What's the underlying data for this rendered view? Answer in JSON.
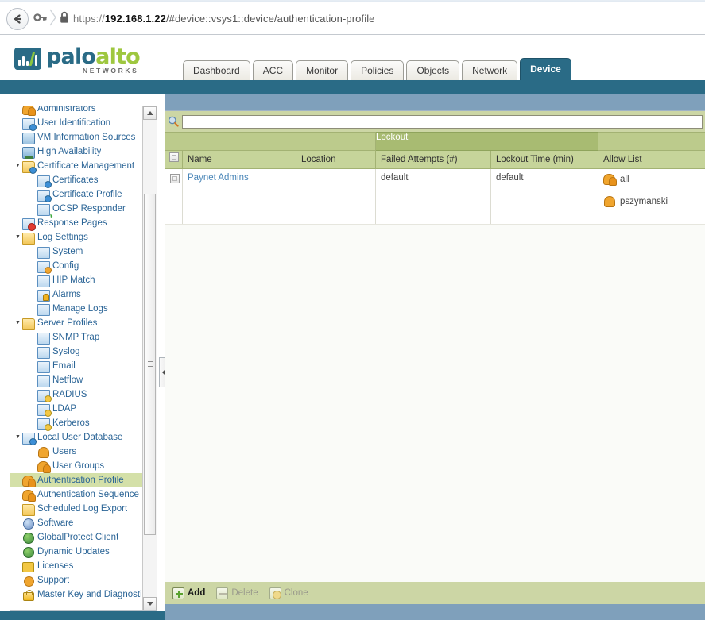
{
  "browser": {
    "url_scheme": "https://",
    "url_host": "192.168.1.22",
    "url_path": "/#device::vsys1::device/authentication-profile",
    "back_icon": "back-arrow-icon",
    "permission_icon": "key-permission-icon",
    "lock_icon": "padlock-secure-icon"
  },
  "brand": {
    "name_part1": "palo",
    "name_part2": "alto",
    "tagline": "NETWORKS",
    "color_primary": "#2a6b86",
    "color_accent": "#9ec73f"
  },
  "tabs": [
    {
      "label": "Dashboard",
      "active": false
    },
    {
      "label": "ACC",
      "active": false
    },
    {
      "label": "Monitor",
      "active": false
    },
    {
      "label": "Policies",
      "active": false
    },
    {
      "label": "Objects",
      "active": false
    },
    {
      "label": "Network",
      "active": false
    },
    {
      "label": "Device",
      "active": true
    }
  ],
  "sidebar": {
    "items": [
      {
        "label": "Administrators",
        "depth": 1,
        "icon": "users-icon",
        "expander": "",
        "selected": false
      },
      {
        "label": "User Identification",
        "depth": 1,
        "icon": "user-id-card-icon",
        "expander": "",
        "selected": false
      },
      {
        "label": "VM Information Sources",
        "depth": 1,
        "icon": "monitor-icon",
        "expander": "",
        "selected": false
      },
      {
        "label": "High Availability",
        "depth": 1,
        "icon": "high-availability-icon",
        "expander": "",
        "selected": false
      },
      {
        "label": "Certificate Management",
        "depth": 1,
        "icon": "folder-certificate-icon",
        "expander": "▼",
        "selected": false
      },
      {
        "label": "Certificates",
        "depth": 2,
        "icon": "certificate-icon",
        "expander": "",
        "selected": false
      },
      {
        "label": "Certificate Profile",
        "depth": 2,
        "icon": "certificate-icon",
        "expander": "",
        "selected": false
      },
      {
        "label": "OCSP Responder",
        "depth": 2,
        "icon": "certificate-check-icon",
        "expander": "",
        "selected": false
      },
      {
        "label": "Response Pages",
        "depth": 1,
        "icon": "response-pages-blocked-icon",
        "expander": "",
        "selected": false
      },
      {
        "label": "Log Settings",
        "depth": 1,
        "icon": "folder-log-icon",
        "expander": "▼",
        "selected": false
      },
      {
        "label": "System",
        "depth": 2,
        "icon": "system-log-icon",
        "expander": "",
        "selected": false
      },
      {
        "label": "Config",
        "depth": 2,
        "icon": "config-log-icon",
        "expander": "",
        "selected": false
      },
      {
        "label": "HIP Match",
        "depth": 2,
        "icon": "hip-match-icon",
        "expander": "",
        "selected": false
      },
      {
        "label": "Alarms",
        "depth": 2,
        "icon": "alarms-bell-icon",
        "expander": "",
        "selected": false
      },
      {
        "label": "Manage Logs",
        "depth": 2,
        "icon": "manage-logs-icon",
        "expander": "",
        "selected": false
      },
      {
        "label": "Server Profiles",
        "depth": 1,
        "icon": "folder-server-icon",
        "expander": "▼",
        "selected": false
      },
      {
        "label": "SNMP Trap",
        "depth": 2,
        "icon": "server-profile-icon",
        "expander": "",
        "selected": false
      },
      {
        "label": "Syslog",
        "depth": 2,
        "icon": "server-profile-icon",
        "expander": "",
        "selected": false
      },
      {
        "label": "Email",
        "depth": 2,
        "icon": "server-profile-icon",
        "expander": "",
        "selected": false
      },
      {
        "label": "Netflow",
        "depth": 2,
        "icon": "server-profile-icon",
        "expander": "",
        "selected": false
      },
      {
        "label": "RADIUS",
        "depth": 2,
        "icon": "server-lock-icon",
        "expander": "",
        "selected": false
      },
      {
        "label": "LDAP",
        "depth": 2,
        "icon": "server-lock-icon",
        "expander": "",
        "selected": false
      },
      {
        "label": "Kerberos",
        "depth": 2,
        "icon": "server-lock-icon",
        "expander": "",
        "selected": false
      },
      {
        "label": "Local User Database",
        "depth": 1,
        "icon": "user-database-icon",
        "expander": "▼",
        "selected": false
      },
      {
        "label": "Users",
        "depth": 2,
        "icon": "user-icon",
        "expander": "",
        "selected": false
      },
      {
        "label": "User Groups",
        "depth": 2,
        "icon": "user-group-icon",
        "expander": "",
        "selected": false
      },
      {
        "label": "Authentication Profile",
        "depth": 1,
        "icon": "authentication-profile-icon",
        "expander": "",
        "selected": true
      },
      {
        "label": "Authentication Sequence",
        "depth": 1,
        "icon": "authentication-sequence-icon",
        "expander": "",
        "selected": false
      },
      {
        "label": "Scheduled Log Export",
        "depth": 1,
        "icon": "scheduled-log-export-icon",
        "expander": "",
        "selected": false
      },
      {
        "label": "Software",
        "depth": 1,
        "icon": "software-icon",
        "expander": "",
        "selected": false
      },
      {
        "label": "GlobalProtect Client",
        "depth": 1,
        "icon": "globalprotect-client-icon",
        "expander": "",
        "selected": false
      },
      {
        "label": "Dynamic Updates",
        "depth": 1,
        "icon": "dynamic-updates-icon",
        "expander": "",
        "selected": false
      },
      {
        "label": "Licenses",
        "depth": 1,
        "icon": "license-key-icon",
        "expander": "",
        "selected": false
      },
      {
        "label": "Support",
        "depth": 1,
        "icon": "support-icon",
        "expander": "",
        "selected": false
      },
      {
        "label": "Master Key and Diagnostics",
        "depth": 1,
        "icon": "master-key-lock-icon",
        "expander": "",
        "selected": false
      }
    ]
  },
  "search": {
    "value": "",
    "placeholder": "",
    "icon": "search-magnifier-icon"
  },
  "table": {
    "group_headers": [
      {
        "label": "",
        "span": 3
      },
      {
        "label": "Lockout",
        "span": 2
      },
      {
        "label": "",
        "span": 1
      }
    ],
    "columns": [
      "Name",
      "Location",
      "Failed Attempts (#)",
      "Lockout Time (min)",
      "Allow List"
    ],
    "rows": [
      {
        "name": "Paynet Admins",
        "location": "",
        "failed_attempts": "default",
        "lockout_time": "default",
        "allow_list": [
          {
            "label": "all",
            "icon": "user-group-icon"
          },
          {
            "label": "pszymanski",
            "icon": "user-icon"
          }
        ]
      }
    ]
  },
  "footer": {
    "buttons": [
      {
        "label": "Add",
        "icon": "plus-icon",
        "enabled": true
      },
      {
        "label": "Delete",
        "icon": "minus-icon",
        "enabled": false
      },
      {
        "label": "Clone",
        "icon": "clone-icon",
        "enabled": false
      }
    ]
  }
}
